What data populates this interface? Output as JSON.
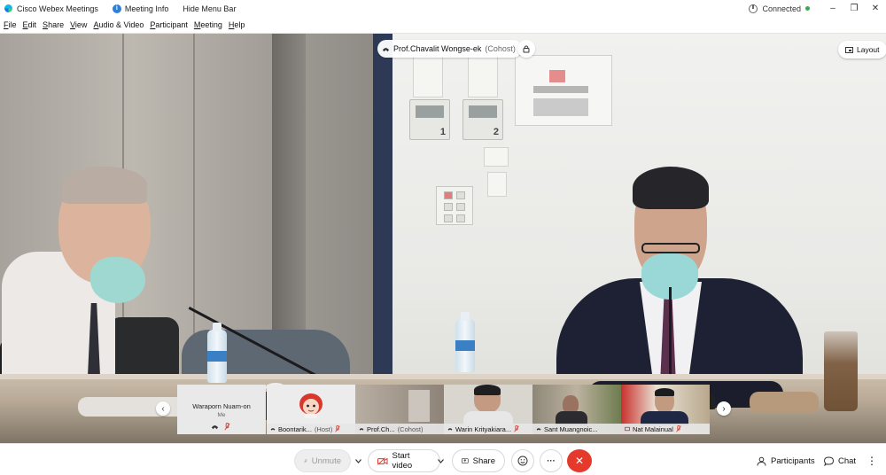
{
  "titlebar": {
    "app_name": "Cisco Webex Meetings",
    "meeting_info": "Meeting Info",
    "hide_menu": "Hide Menu Bar",
    "status": "Connected",
    "minimize": "–",
    "restore": "❐",
    "close": "✕"
  },
  "menubar": {
    "items": [
      {
        "u": "F",
        "rest": "ile"
      },
      {
        "u": "E",
        "rest": "dit"
      },
      {
        "u": "S",
        "rest": "hare"
      },
      {
        "u": "V",
        "rest": "iew"
      },
      {
        "u": "A",
        "rest": "udio & Video"
      },
      {
        "u": "P",
        "rest": "articipant"
      },
      {
        "u": "M",
        "rest": "eeting"
      },
      {
        "u": "H",
        "rest": "elp"
      }
    ]
  },
  "active_speaker": {
    "name": "Prof.Chavalit Wongse-ek",
    "role": "(Cohost)"
  },
  "layout_button": "Layout",
  "scene": {
    "thermostat_1": "1",
    "thermostat_2": "2"
  },
  "filmstrip": {
    "prev": "‹",
    "next": "›",
    "self_tile": {
      "name": "Waraporn Nuam-on",
      "sub": "Me"
    },
    "tiles": [
      {
        "name": "Boontarik...",
        "role": "(Host)"
      },
      {
        "name": "Prof.Ch...",
        "role": "(Cohost)"
      },
      {
        "name": "Warin Krityakiara...",
        "role": ""
      },
      {
        "name": "Sant Muangnoic...",
        "role": ""
      },
      {
        "name": "Nat Malainual",
        "role": ""
      }
    ]
  },
  "controls": {
    "unmute": "Unmute",
    "start_video": "Start video",
    "share": "Share",
    "reactions_icon": "smiley-icon",
    "more": "···",
    "end": "✕",
    "participants": "Participants",
    "chat": "Chat",
    "more_right": "⋮"
  },
  "colors": {
    "end_button": "#e5392b",
    "accent_blue": "#2e7fd6",
    "connected_green": "#2bb24c",
    "muted_red": "#d9372b"
  }
}
